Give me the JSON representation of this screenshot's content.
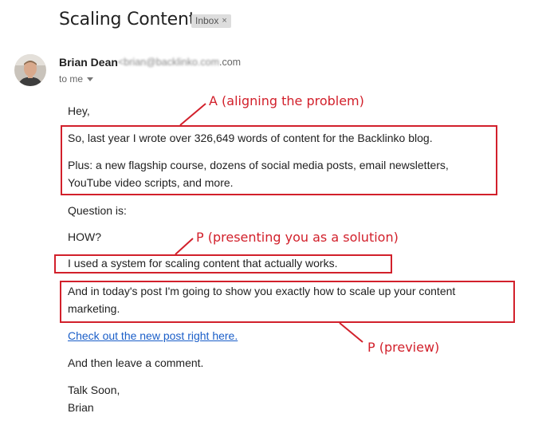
{
  "email": {
    "subject": "Scaling Content",
    "label_chip": "Inbox",
    "label_chip_close": "×",
    "sender_name": "Brian Dean",
    "sender_email": "‌                                    .com",
    "recipient_line": "to me"
  },
  "body": {
    "greeting": "Hey,",
    "p1": "So, last year I wrote over 326,649 words of content for the Backlinko blog.",
    "p2_line1": "Plus: a new flagship course, dozens of social media posts, email newsletters,",
    "p2_line2": "YouTube video scripts, and more.",
    "p3": "Question is:",
    "p4": "HOW?",
    "p5": "I used a system for scaling content that actually works.",
    "p6_line1": "And in today's post I'm going to show you exactly how to scale up your content",
    "p6_line2": "marketing.",
    "link": "Check out the new post right here.",
    "p7": "And then leave a comment.",
    "signoff": "Talk Soon,",
    "signature": "Brian"
  },
  "annotations": {
    "a": "A (aligning the problem)",
    "p_solution": "P (presenting you as a solution)",
    "p_preview": "P (preview)"
  },
  "colors": {
    "annotation_red": "#d2202b",
    "link_blue": "#1a5ec8",
    "chip_bg": "#dddddd"
  },
  "icons": {
    "dropdown": "caret-down-icon",
    "avatar": "sender-avatar"
  }
}
